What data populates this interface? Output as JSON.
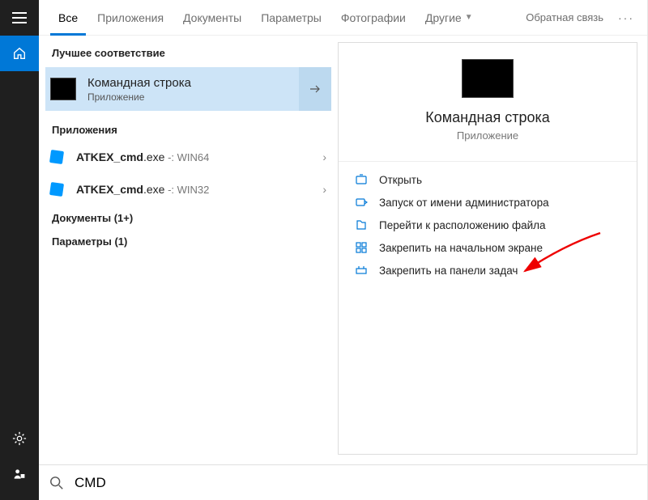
{
  "tabs": {
    "all": "Все",
    "apps": "Приложения",
    "docs": "Документы",
    "settings": "Параметры",
    "photos": "Фотографии",
    "other": "Другие",
    "feedback": "Обратная связь"
  },
  "sections": {
    "best_match": "Лучшее соответствие",
    "apps": "Приложения",
    "docs": "Документы (1+)",
    "settings": "Параметры (1)"
  },
  "best": {
    "title": "Командная строка",
    "sub": "Приложение"
  },
  "files": [
    {
      "name_bold": "ATKEX_cmd",
      "name_rest": ".exe",
      "suffix": " -: WIN64"
    },
    {
      "name_bold": "ATKEX_cmd",
      "name_rest": ".exe",
      "suffix": " -: WIN32"
    }
  ],
  "detail": {
    "title": "Командная строка",
    "sub": "Приложение"
  },
  "actions": {
    "open": "Открыть",
    "run_admin": "Запуск от имени администратора",
    "open_location": "Перейти к расположению файла",
    "pin_start": "Закрепить на начальном экране",
    "pin_taskbar": "Закрепить на панели задач"
  },
  "search": {
    "value": "CMD"
  }
}
